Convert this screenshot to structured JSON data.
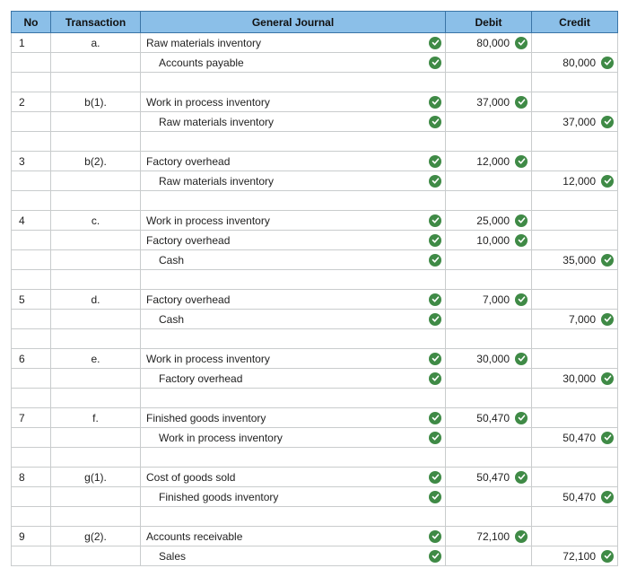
{
  "headers": {
    "no": "No",
    "transaction": "Transaction",
    "general_journal": "General Journal",
    "debit": "Debit",
    "credit": "Credit"
  },
  "rows": [
    {
      "no": "1",
      "txn": "a.",
      "gj": "Raw materials inventory",
      "gj_check": true,
      "gj_indent": false,
      "debit": "80,000",
      "debit_check": true,
      "credit": "",
      "credit_check": false
    },
    {
      "no": "",
      "txn": "",
      "gj": "Accounts payable",
      "gj_check": true,
      "gj_indent": true,
      "debit": "",
      "debit_check": false,
      "credit": "80,000",
      "credit_check": true
    },
    {
      "no": "",
      "txn": "",
      "gj": "",
      "gj_check": false,
      "gj_indent": false,
      "debit": "",
      "debit_check": false,
      "credit": "",
      "credit_check": false
    },
    {
      "no": "2",
      "txn": "b(1).",
      "gj": "Work in process inventory",
      "gj_check": true,
      "gj_indent": false,
      "debit": "37,000",
      "debit_check": true,
      "credit": "",
      "credit_check": false
    },
    {
      "no": "",
      "txn": "",
      "gj": "Raw materials inventory",
      "gj_check": true,
      "gj_indent": true,
      "debit": "",
      "debit_check": false,
      "credit": "37,000",
      "credit_check": true
    },
    {
      "no": "",
      "txn": "",
      "gj": "",
      "gj_check": false,
      "gj_indent": false,
      "debit": "",
      "debit_check": false,
      "credit": "",
      "credit_check": false
    },
    {
      "no": "3",
      "txn": "b(2).",
      "gj": "Factory overhead",
      "gj_check": true,
      "gj_indent": false,
      "debit": "12,000",
      "debit_check": true,
      "credit": "",
      "credit_check": false
    },
    {
      "no": "",
      "txn": "",
      "gj": "Raw materials inventory",
      "gj_check": true,
      "gj_indent": true,
      "debit": "",
      "debit_check": false,
      "credit": "12,000",
      "credit_check": true
    },
    {
      "no": "",
      "txn": "",
      "gj": "",
      "gj_check": false,
      "gj_indent": false,
      "debit": "",
      "debit_check": false,
      "credit": "",
      "credit_check": false
    },
    {
      "no": "4",
      "txn": "c.",
      "gj": "Work in process inventory",
      "gj_check": true,
      "gj_indent": false,
      "debit": "25,000",
      "debit_check": true,
      "credit": "",
      "credit_check": false
    },
    {
      "no": "",
      "txn": "",
      "gj": "Factory overhead",
      "gj_check": true,
      "gj_indent": false,
      "debit": "10,000",
      "debit_check": true,
      "credit": "",
      "credit_check": false
    },
    {
      "no": "",
      "txn": "",
      "gj": "Cash",
      "gj_check": true,
      "gj_indent": true,
      "debit": "",
      "debit_check": false,
      "credit": "35,000",
      "credit_check": true
    },
    {
      "no": "",
      "txn": "",
      "gj": "",
      "gj_check": false,
      "gj_indent": false,
      "debit": "",
      "debit_check": false,
      "credit": "",
      "credit_check": false
    },
    {
      "no": "5",
      "txn": "d.",
      "gj": "Factory overhead",
      "gj_check": true,
      "gj_indent": false,
      "debit": "7,000",
      "debit_check": true,
      "credit": "",
      "credit_check": false
    },
    {
      "no": "",
      "txn": "",
      "gj": "Cash",
      "gj_check": true,
      "gj_indent": true,
      "debit": "",
      "debit_check": false,
      "credit": "7,000",
      "credit_check": true
    },
    {
      "no": "",
      "txn": "",
      "gj": "",
      "gj_check": false,
      "gj_indent": false,
      "debit": "",
      "debit_check": false,
      "credit": "",
      "credit_check": false
    },
    {
      "no": "6",
      "txn": "e.",
      "gj": "Work in process inventory",
      "gj_check": true,
      "gj_indent": false,
      "debit": "30,000",
      "debit_check": true,
      "credit": "",
      "credit_check": false
    },
    {
      "no": "",
      "txn": "",
      "gj": "Factory overhead",
      "gj_check": true,
      "gj_indent": true,
      "debit": "",
      "debit_check": false,
      "credit": "30,000",
      "credit_check": true
    },
    {
      "no": "",
      "txn": "",
      "gj": "",
      "gj_check": false,
      "gj_indent": false,
      "debit": "",
      "debit_check": false,
      "credit": "",
      "credit_check": false
    },
    {
      "no": "7",
      "txn": "f.",
      "gj": "Finished goods inventory",
      "gj_check": true,
      "gj_indent": false,
      "debit": "50,470",
      "debit_check": true,
      "credit": "",
      "credit_check": false
    },
    {
      "no": "",
      "txn": "",
      "gj": "Work in process inventory",
      "gj_check": true,
      "gj_indent": true,
      "debit": "",
      "debit_check": false,
      "credit": "50,470",
      "credit_check": true
    },
    {
      "no": "",
      "txn": "",
      "gj": "",
      "gj_check": false,
      "gj_indent": false,
      "debit": "",
      "debit_check": false,
      "credit": "",
      "credit_check": false
    },
    {
      "no": "8",
      "txn": "g(1).",
      "gj": "Cost of goods sold",
      "gj_check": true,
      "gj_indent": false,
      "debit": "50,470",
      "debit_check": true,
      "credit": "",
      "credit_check": false
    },
    {
      "no": "",
      "txn": "",
      "gj": "Finished goods inventory",
      "gj_check": true,
      "gj_indent": true,
      "debit": "",
      "debit_check": false,
      "credit": "50,470",
      "credit_check": true
    },
    {
      "no": "",
      "txn": "",
      "gj": "",
      "gj_check": false,
      "gj_indent": false,
      "debit": "",
      "debit_check": false,
      "credit": "",
      "credit_check": false
    },
    {
      "no": "9",
      "txn": "g(2).",
      "gj": "Accounts receivable",
      "gj_check": true,
      "gj_indent": false,
      "debit": "72,100",
      "debit_check": true,
      "credit": "",
      "credit_check": false
    },
    {
      "no": "",
      "txn": "",
      "gj": "Sales",
      "gj_check": true,
      "gj_indent": true,
      "debit": "",
      "debit_check": false,
      "credit": "72,100",
      "credit_check": true
    }
  ]
}
